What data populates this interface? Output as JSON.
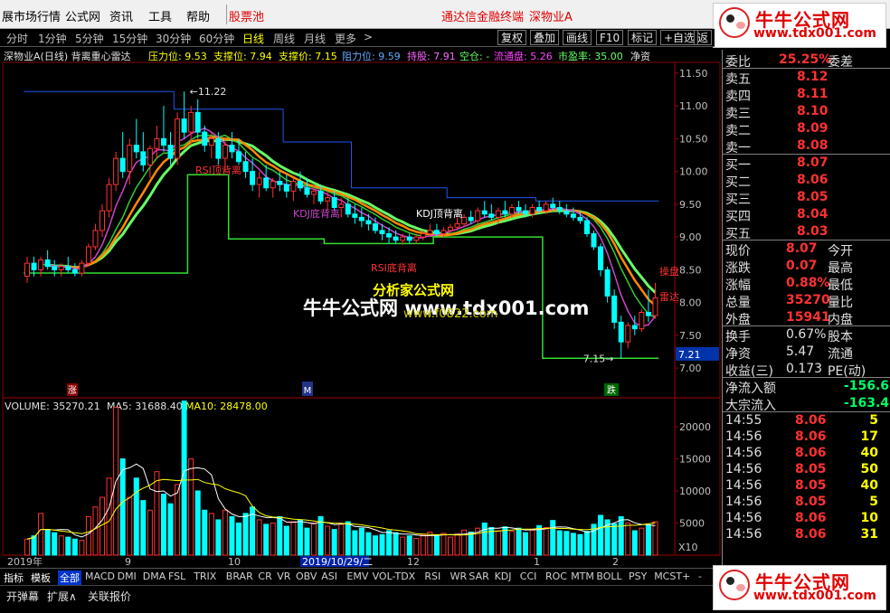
{
  "menu": {
    "items": [
      "展市场行情",
      "公式网",
      "资讯",
      "工具",
      "帮助",
      "股票池"
    ],
    "tdx_label": "通达信金融终端",
    "stock_label": "深物业A"
  },
  "brand": {
    "name": "牛牛公式网",
    "url": "www.tdx001.com"
  },
  "periods": {
    "items": [
      "分时",
      "1分钟",
      "5分钟",
      "15分钟",
      "30分钟",
      "60分钟",
      "日线",
      "周线",
      "月线",
      "更多"
    ],
    "active": "日线",
    "more_arrow": ">"
  },
  "toolbar": {
    "items": [
      "复权",
      "叠加",
      "画线",
      "F10",
      "标记",
      "+自选",
      "返"
    ]
  },
  "indicator_header": {
    "title": "深物业A(日线) 背离重心雷达",
    "pressure": "压力位: 9.53",
    "support": "支撑位: 7.94",
    "support_price": "支撑价: 7.15",
    "resist": "阻力位: 9.59",
    "hold": "持股: 7.91",
    "empty": "空仓: -",
    "float": "流通盘: 5.26",
    "pe": "市盈率: 35.00",
    "net": "净资"
  },
  "chart_data": [
    {
      "type": "candlestick",
      "title": "深物业A(日线) 背离重心雷达",
      "price_axis": [
        "11.50",
        "11.00",
        "10.50",
        "10.00",
        "9.50",
        "9.00",
        "8.50",
        "8.00",
        "7.50",
        "7.00"
      ],
      "ylim": [
        6.85,
        11.65
      ],
      "current_price_tag": "7.21",
      "high_label": "11.22",
      "low_label": "7.15",
      "annotations": [
        "RSI顶背离",
        "KDJ底背离",
        "KDJ顶背离",
        "RSI底背离",
        "操盘",
        "雷达"
      ],
      "markers": [
        "涨",
        "M",
        "跌"
      ],
      "candles": [
        [
          8.4,
          8.7,
          8.3,
          8.6
        ],
        [
          8.6,
          8.7,
          8.4,
          8.5
        ],
        [
          8.5,
          8.7,
          8.4,
          8.65
        ],
        [
          8.65,
          8.8,
          8.5,
          8.55
        ],
        [
          8.55,
          8.65,
          8.4,
          8.5
        ],
        [
          8.5,
          8.6,
          8.4,
          8.55
        ],
        [
          8.55,
          8.7,
          8.45,
          8.5
        ],
        [
          8.5,
          8.6,
          8.4,
          8.45
        ],
        [
          8.45,
          8.65,
          8.4,
          8.6
        ],
        [
          8.6,
          8.9,
          8.55,
          8.85
        ],
        [
          8.85,
          9.2,
          8.8,
          9.1
        ],
        [
          9.1,
          9.5,
          9.0,
          9.4
        ],
        [
          9.4,
          9.9,
          9.3,
          9.8
        ],
        [
          9.8,
          10.3,
          9.7,
          10.2
        ],
        [
          10.2,
          10.6,
          9.9,
          10.0
        ],
        [
          10.0,
          10.5,
          9.8,
          10.4
        ],
        [
          10.4,
          10.8,
          10.2,
          10.3
        ],
        [
          10.3,
          10.6,
          10.0,
          10.1
        ],
        [
          10.1,
          10.4,
          9.9,
          10.35
        ],
        [
          10.35,
          10.7,
          10.2,
          10.5
        ],
        [
          10.5,
          11.0,
          10.3,
          10.4
        ],
        [
          10.4,
          10.6,
          10.1,
          10.2
        ],
        [
          10.2,
          10.9,
          10.1,
          10.8
        ],
        [
          10.8,
          11.22,
          10.5,
          10.6
        ],
        [
          10.6,
          11.0,
          10.4,
          10.9
        ],
        [
          10.9,
          11.1,
          10.5,
          10.6
        ],
        [
          10.6,
          10.7,
          10.3,
          10.4
        ],
        [
          10.4,
          10.6,
          10.2,
          10.5
        ],
        [
          10.5,
          10.6,
          10.1,
          10.2
        ],
        [
          10.2,
          10.5,
          10.0,
          10.4
        ],
        [
          10.4,
          10.6,
          10.2,
          10.3
        ],
        [
          10.3,
          10.5,
          10.1,
          10.15
        ],
        [
          10.15,
          10.3,
          9.9,
          10.0
        ],
        [
          10.0,
          10.2,
          9.7,
          9.8
        ],
        [
          9.8,
          10.0,
          9.6,
          9.9
        ],
        [
          9.9,
          10.1,
          9.7,
          9.75
        ],
        [
          9.75,
          9.9,
          9.6,
          9.85
        ],
        [
          9.85,
          10.0,
          9.7,
          9.8
        ],
        [
          9.8,
          9.95,
          9.6,
          9.7
        ],
        [
          9.7,
          9.9,
          9.55,
          9.85
        ],
        [
          9.85,
          10.0,
          9.7,
          9.75
        ],
        [
          9.75,
          9.9,
          9.6,
          9.65
        ],
        [
          9.65,
          9.8,
          9.5,
          9.7
        ],
        [
          9.7,
          9.8,
          9.5,
          9.55
        ],
        [
          9.55,
          9.7,
          9.4,
          9.6
        ],
        [
          9.6,
          9.7,
          9.4,
          9.45
        ],
        [
          9.45,
          9.6,
          9.3,
          9.5
        ],
        [
          9.5,
          9.6,
          9.3,
          9.35
        ],
        [
          9.35,
          9.5,
          9.2,
          9.3
        ],
        [
          9.3,
          9.45,
          9.15,
          9.25
        ],
        [
          9.25,
          9.35,
          9.1,
          9.2
        ],
        [
          9.2,
          9.3,
          9.05,
          9.1
        ],
        [
          9.1,
          9.2,
          8.95,
          9.05
        ],
        [
          9.05,
          9.15,
          8.9,
          9.0
        ],
        [
          9.0,
          9.1,
          8.9,
          8.95
        ],
        [
          8.95,
          9.05,
          8.88,
          9.0
        ],
        [
          9.0,
          9.05,
          8.9,
          8.95
        ],
        [
          8.95,
          9.05,
          8.9,
          9.0
        ],
        [
          9.0,
          9.1,
          8.95,
          9.05
        ],
        [
          9.05,
          9.2,
          9.0,
          9.1
        ],
        [
          9.1,
          9.2,
          9.0,
          9.05
        ],
        [
          9.05,
          9.15,
          9.0,
          9.1
        ],
        [
          9.1,
          9.2,
          9.05,
          9.15
        ],
        [
          9.15,
          9.3,
          9.1,
          9.2
        ],
        [
          9.2,
          9.35,
          9.15,
          9.3
        ],
        [
          9.3,
          9.4,
          9.2,
          9.25
        ],
        [
          9.25,
          9.45,
          9.2,
          9.4
        ],
        [
          9.4,
          9.55,
          9.3,
          9.35
        ],
        [
          9.35,
          9.5,
          9.25,
          9.3
        ],
        [
          9.3,
          9.45,
          9.2,
          9.4
        ],
        [
          9.4,
          9.55,
          9.3,
          9.35
        ],
        [
          9.35,
          9.5,
          9.3,
          9.45
        ],
        [
          9.45,
          9.55,
          9.35,
          9.4
        ],
        [
          9.4,
          9.5,
          9.3,
          9.35
        ],
        [
          9.35,
          9.5,
          9.3,
          9.45
        ],
        [
          9.45,
          9.55,
          9.35,
          9.4
        ],
        [
          9.4,
          9.55,
          9.35,
          9.5
        ],
        [
          9.5,
          9.6,
          9.4,
          9.45
        ],
        [
          9.45,
          9.55,
          9.35,
          9.4
        ],
        [
          9.4,
          9.5,
          9.3,
          9.35
        ],
        [
          9.35,
          9.45,
          9.25,
          9.3
        ],
        [
          9.3,
          9.4,
          9.2,
          9.25
        ],
        [
          9.25,
          9.3,
          9.0,
          9.05
        ],
        [
          9.05,
          9.1,
          8.8,
          8.85
        ],
        [
          8.85,
          8.9,
          8.4,
          8.5
        ],
        [
          8.5,
          8.55,
          8.0,
          8.1
        ],
        [
          8.1,
          8.2,
          7.6,
          7.7
        ],
        [
          7.7,
          7.8,
          7.15,
          7.4
        ],
        [
          7.4,
          7.7,
          7.3,
          7.65
        ],
        [
          7.65,
          7.8,
          7.5,
          7.6
        ],
        [
          7.6,
          7.9,
          7.55,
          7.85
        ],
        [
          7.85,
          8.2,
          7.7,
          7.8
        ],
        [
          7.8,
          8.3,
          7.75,
          8.07
        ]
      ]
    },
    {
      "type": "bar",
      "title": "VOLUME",
      "legend": {
        "volume": "VOLUME: 35270.21",
        "ma5": "MA5: 31688.40",
        "ma10": "MA10: 28478.00"
      },
      "y_ticks": [
        "20000",
        "15000",
        "10000",
        "5000"
      ],
      "ylim": [
        0,
        24500
      ],
      "scale_label": "X10",
      "x_ticks": [
        "2019年",
        "9",
        "10",
        "2019/10/29/二",
        "12",
        "1",
        "2"
      ],
      "values": [
        2500,
        3000,
        6500,
        4000,
        3500,
        3000,
        2800,
        2500,
        2300,
        6000,
        7500,
        9000,
        12000,
        23000,
        15000,
        9000,
        12000,
        8500,
        7000,
        13000,
        9500,
        8000,
        11000,
        24000,
        15000,
        10000,
        7000,
        6500,
        5500,
        7000,
        6000,
        5000,
        6500,
        7500,
        5500,
        4800,
        5000,
        6000,
        4500,
        5200,
        5500,
        4200,
        5000,
        6000,
        4500,
        4000,
        4800,
        5200,
        3800,
        4200,
        3500,
        3000,
        3200,
        3800,
        3500,
        2800,
        3000,
        2600,
        3200,
        3600,
        3000,
        3400,
        2800,
        3300,
        3900,
        3600,
        4200,
        5000,
        4300,
        3800,
        4400,
        3700,
        4200,
        3500,
        3900,
        4600,
        4300,
        5400,
        3800,
        3700,
        3400,
        3200,
        3700,
        4800,
        6200,
        5500,
        4900,
        6000,
        5000,
        3800,
        4200,
        4700,
        5200,
        4600,
        3800
      ]
    }
  ],
  "quote": {
    "ratio_label": "委比",
    "ratio": "25.25%",
    "diff_label": "委差",
    "asks": [
      [
        "卖五",
        "8.12"
      ],
      [
        "卖四",
        "8.11"
      ],
      [
        "卖三",
        "8.10"
      ],
      [
        "卖二",
        "8.09"
      ],
      [
        "卖一",
        "8.08"
      ]
    ],
    "bids": [
      [
        "买一",
        "8.07"
      ],
      [
        "买二",
        "8.06"
      ],
      [
        "买三",
        "8.05"
      ],
      [
        "买四",
        "8.04"
      ],
      [
        "买五",
        "8.03"
      ]
    ],
    "stats": [
      [
        "现价",
        "8.07",
        "今开"
      ],
      [
        "涨跌",
        "0.07",
        "最高"
      ],
      [
        "涨幅",
        "0.88%",
        "最低"
      ],
      [
        "总量",
        "35270",
        "量比"
      ],
      [
        "外盘",
        "15941",
        "内盘"
      ]
    ],
    "stats2": [
      [
        "换手",
        "0.67%",
        "股本"
      ],
      [
        "净资",
        "5.47",
        "流通"
      ],
      [
        "收益(三)",
        "0.173",
        "PE(动)"
      ]
    ],
    "netflow": [
      [
        "净流入额",
        "-156.6"
      ],
      [
        "大宗流入",
        "-163.4"
      ]
    ],
    "ticks": [
      [
        "14:55",
        "8.06",
        "5"
      ],
      [
        "14:56",
        "8.06",
        "17"
      ],
      [
        "14:56",
        "8.06",
        "40"
      ],
      [
        "14:56",
        "8.05",
        "50"
      ],
      [
        "14:56",
        "8.05",
        "40"
      ],
      [
        "14:56",
        "8.05",
        "5"
      ],
      [
        "14:56",
        "8.06",
        "10"
      ],
      [
        "14:56",
        "8.06",
        "31"
      ]
    ]
  },
  "indicator_tabs": {
    "items": [
      "指标",
      "模板",
      "全部",
      "MACD",
      "DMI",
      "DMA",
      "FSL",
      "TRIX",
      "BRAR",
      "CR",
      "VR",
      "OBV",
      "ASI",
      "EMV",
      "VOL-TDX",
      "RSI",
      "WR",
      "SAR",
      "KDJ",
      "CCI",
      "ROC",
      "MTM",
      "BOLL",
      "PSY",
      "MCST"
    ],
    "active": "全部",
    "extra": [
      "+",
      "-"
    ]
  },
  "bottom_tabs": {
    "items": [
      "开弹幕",
      "扩展∧",
      "关联报价"
    ]
  },
  "watermarks": {
    "main": "牛牛公式网  www.tdx001.com",
    "sub_title": "分析家公式网",
    "sub_url": "www.f0822.com"
  },
  "colors": {
    "up": "#ff3232",
    "down": "#00ffff",
    "bg": "#000000",
    "grid": "#800000",
    "ma_green": "#66ff66",
    "ma_orange": "#ff8800",
    "resist_blue": "#2255ee",
    "support_green": "#33dd33",
    "magenta": "#cc44cc"
  }
}
